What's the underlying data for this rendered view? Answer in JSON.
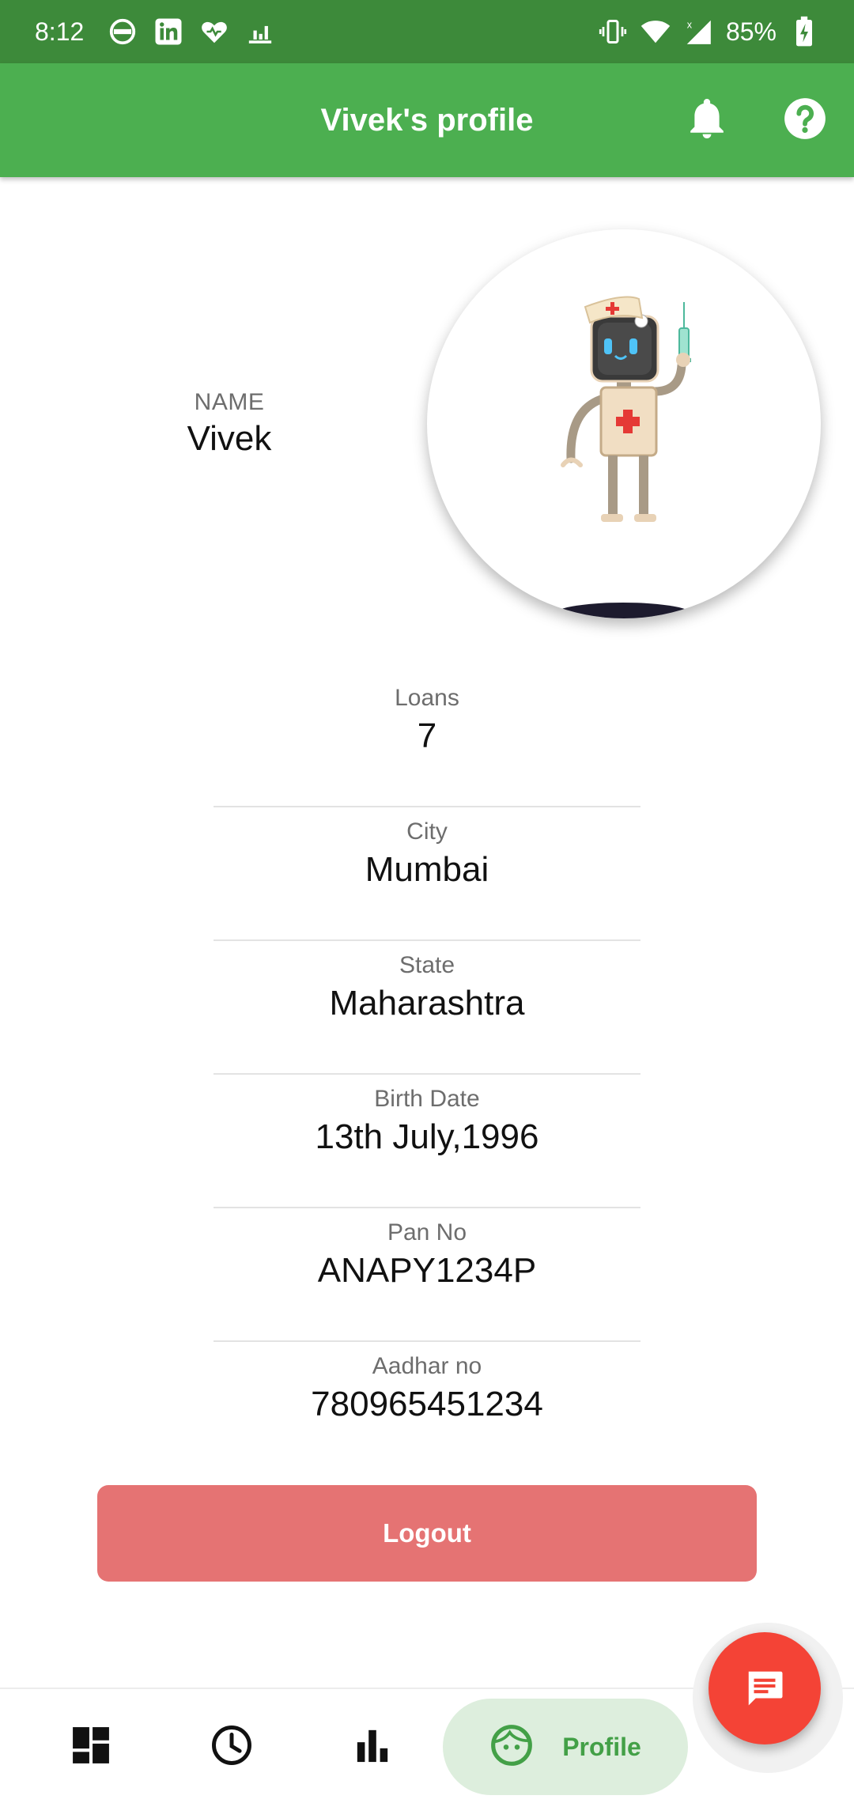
{
  "status_bar": {
    "time": "8:12",
    "icons_left": [
      "sync-icon",
      "linkedin-icon",
      "health-icon",
      "bars-icon"
    ],
    "icons_right": [
      "vibrate-icon",
      "wifi-icon",
      "signal-icon",
      "battery-icon"
    ],
    "battery_percent": "85%"
  },
  "app_bar": {
    "title": "Vivek's profile",
    "actions": [
      "bell-icon",
      "help-icon"
    ]
  },
  "profile": {
    "name_label": "NAME",
    "name_value": "Vivek",
    "avatar": "robot-nurse-avatar"
  },
  "info": [
    {
      "label": "Loans",
      "value": "7"
    },
    {
      "label": "City",
      "value": "Mumbai"
    },
    {
      "label": "State",
      "value": "Maharashtra"
    },
    {
      "label": "Birth Date",
      "value": "13th July,1996"
    },
    {
      "label": "Pan No",
      "value": "ANAPY1234P"
    },
    {
      "label": "Aadhar no",
      "value": "780965451234"
    }
  ],
  "logout_label": "Logout",
  "bottom_nav": {
    "items": [
      "dashboard-icon",
      "history-icon",
      "stats-icon"
    ],
    "active_label": "Profile",
    "active_icon": "face-icon"
  },
  "fab": {
    "icon": "chat-icon"
  },
  "colors": {
    "status_bar": "#3d8a3a",
    "app_bar": "#4caf50",
    "logout": "#e57373",
    "fab": "#f44336",
    "nav_active_bg": "#ddeedd",
    "nav_active_text": "#43a047"
  }
}
